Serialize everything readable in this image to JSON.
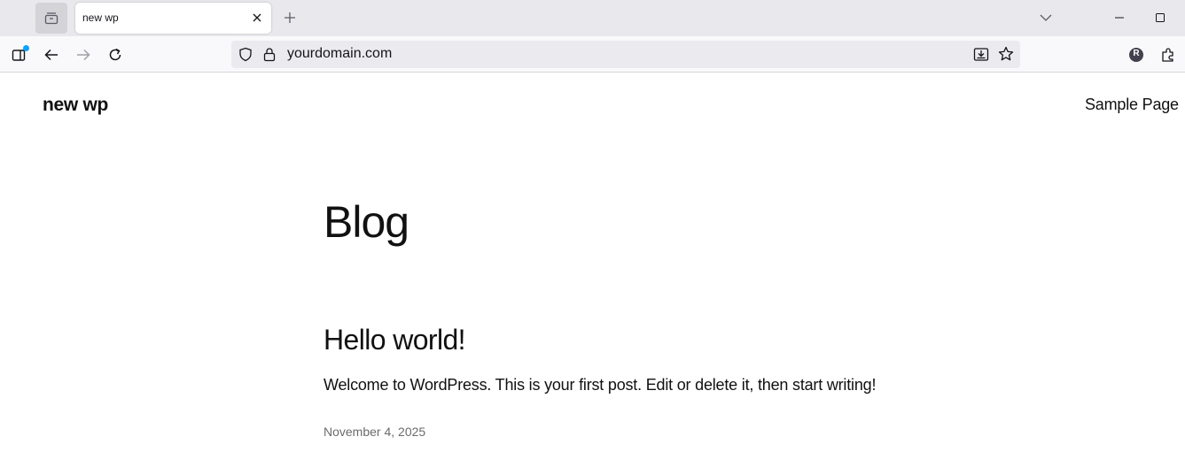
{
  "browser": {
    "tab": {
      "title": "new wp"
    },
    "url": "yourdomain.com",
    "icons": {
      "tab_overview": "tab-overview-icon",
      "close": "close-icon",
      "new_tab": "plus-icon",
      "tab_list": "chevron-down-icon",
      "minimize": "minimize-icon",
      "maximize": "maximize-icon",
      "sidebar": "sidebar-icon",
      "back": "back-arrow-icon",
      "forward": "forward-arrow-icon",
      "reload": "reload-icon",
      "shield": "shield-icon",
      "lock": "lock-icon",
      "install": "download-install-icon",
      "bookmark": "star-icon",
      "profile": "profile-avatar-icon",
      "extensions": "extensions-icon"
    },
    "profile_initial": "R",
    "accent": "#0aa2ff"
  },
  "site": {
    "title": "new wp",
    "nav": {
      "sample_page": "Sample Page"
    }
  },
  "main": {
    "heading": "Blog",
    "posts": [
      {
        "title": "Hello world!",
        "excerpt": "Welcome to WordPress. This is your first post. Edit or delete it, then start writing!",
        "date": "November 4, 2025"
      }
    ]
  }
}
